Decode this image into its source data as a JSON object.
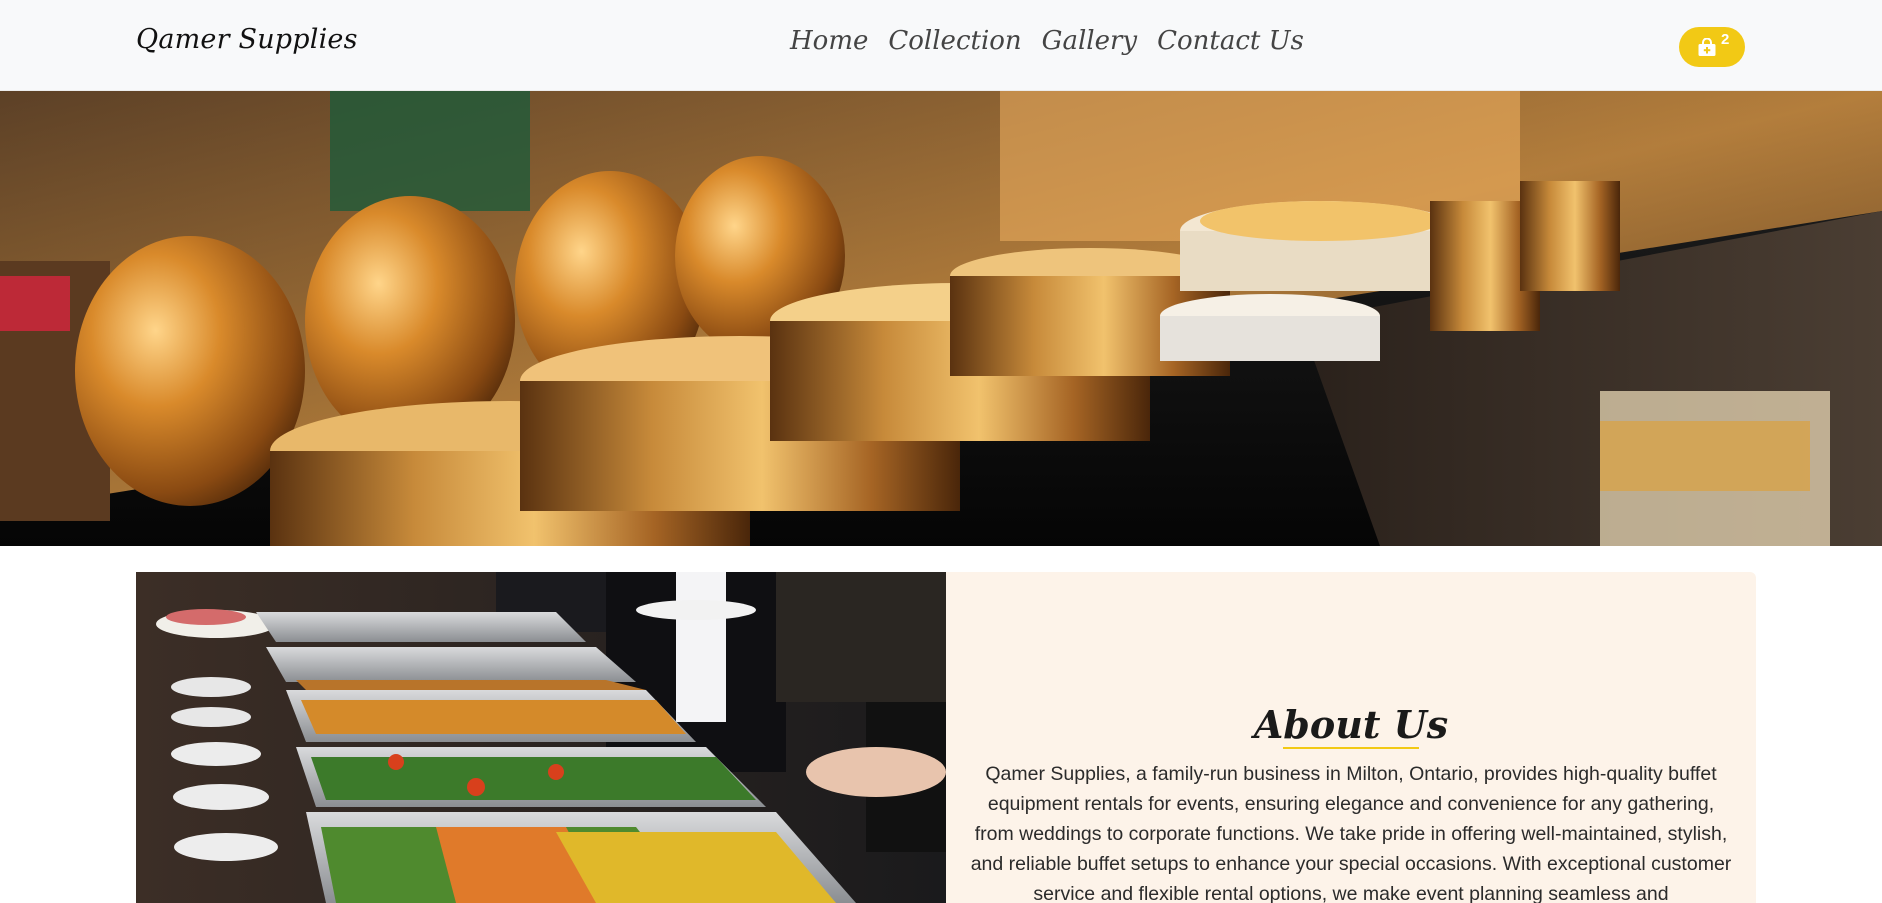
{
  "brand": {
    "name": "Qamer Supplies"
  },
  "nav": {
    "links": [
      {
        "label": "Home"
      },
      {
        "label": "Collection"
      },
      {
        "label": "Gallery"
      },
      {
        "label": "Contact Us"
      }
    ]
  },
  "cart": {
    "count": "2",
    "icon": "shopping-bag-icon"
  },
  "hero": {
    "image": "copper-buffet-chafing-dishes-photo"
  },
  "about": {
    "image": "buffet-line-guests-serving-photo",
    "title": "About Us",
    "text": "Qamer Supplies, a family-run business in Milton, Ontario, provides high-quality buffet equipment rentals for events, ensuring elegance and convenience for any gathering, from weddings to corporate functions. We take pride in offering well-maintained, stylish, and reliable buffet setups to enhance your special occasions. With exceptional customer service and flexible rental options, we make event planning seamless and"
  },
  "colors": {
    "accent": "#f2c915",
    "navbar_bg": "#f8f9fa",
    "card_bg": "#fdf3e9"
  }
}
